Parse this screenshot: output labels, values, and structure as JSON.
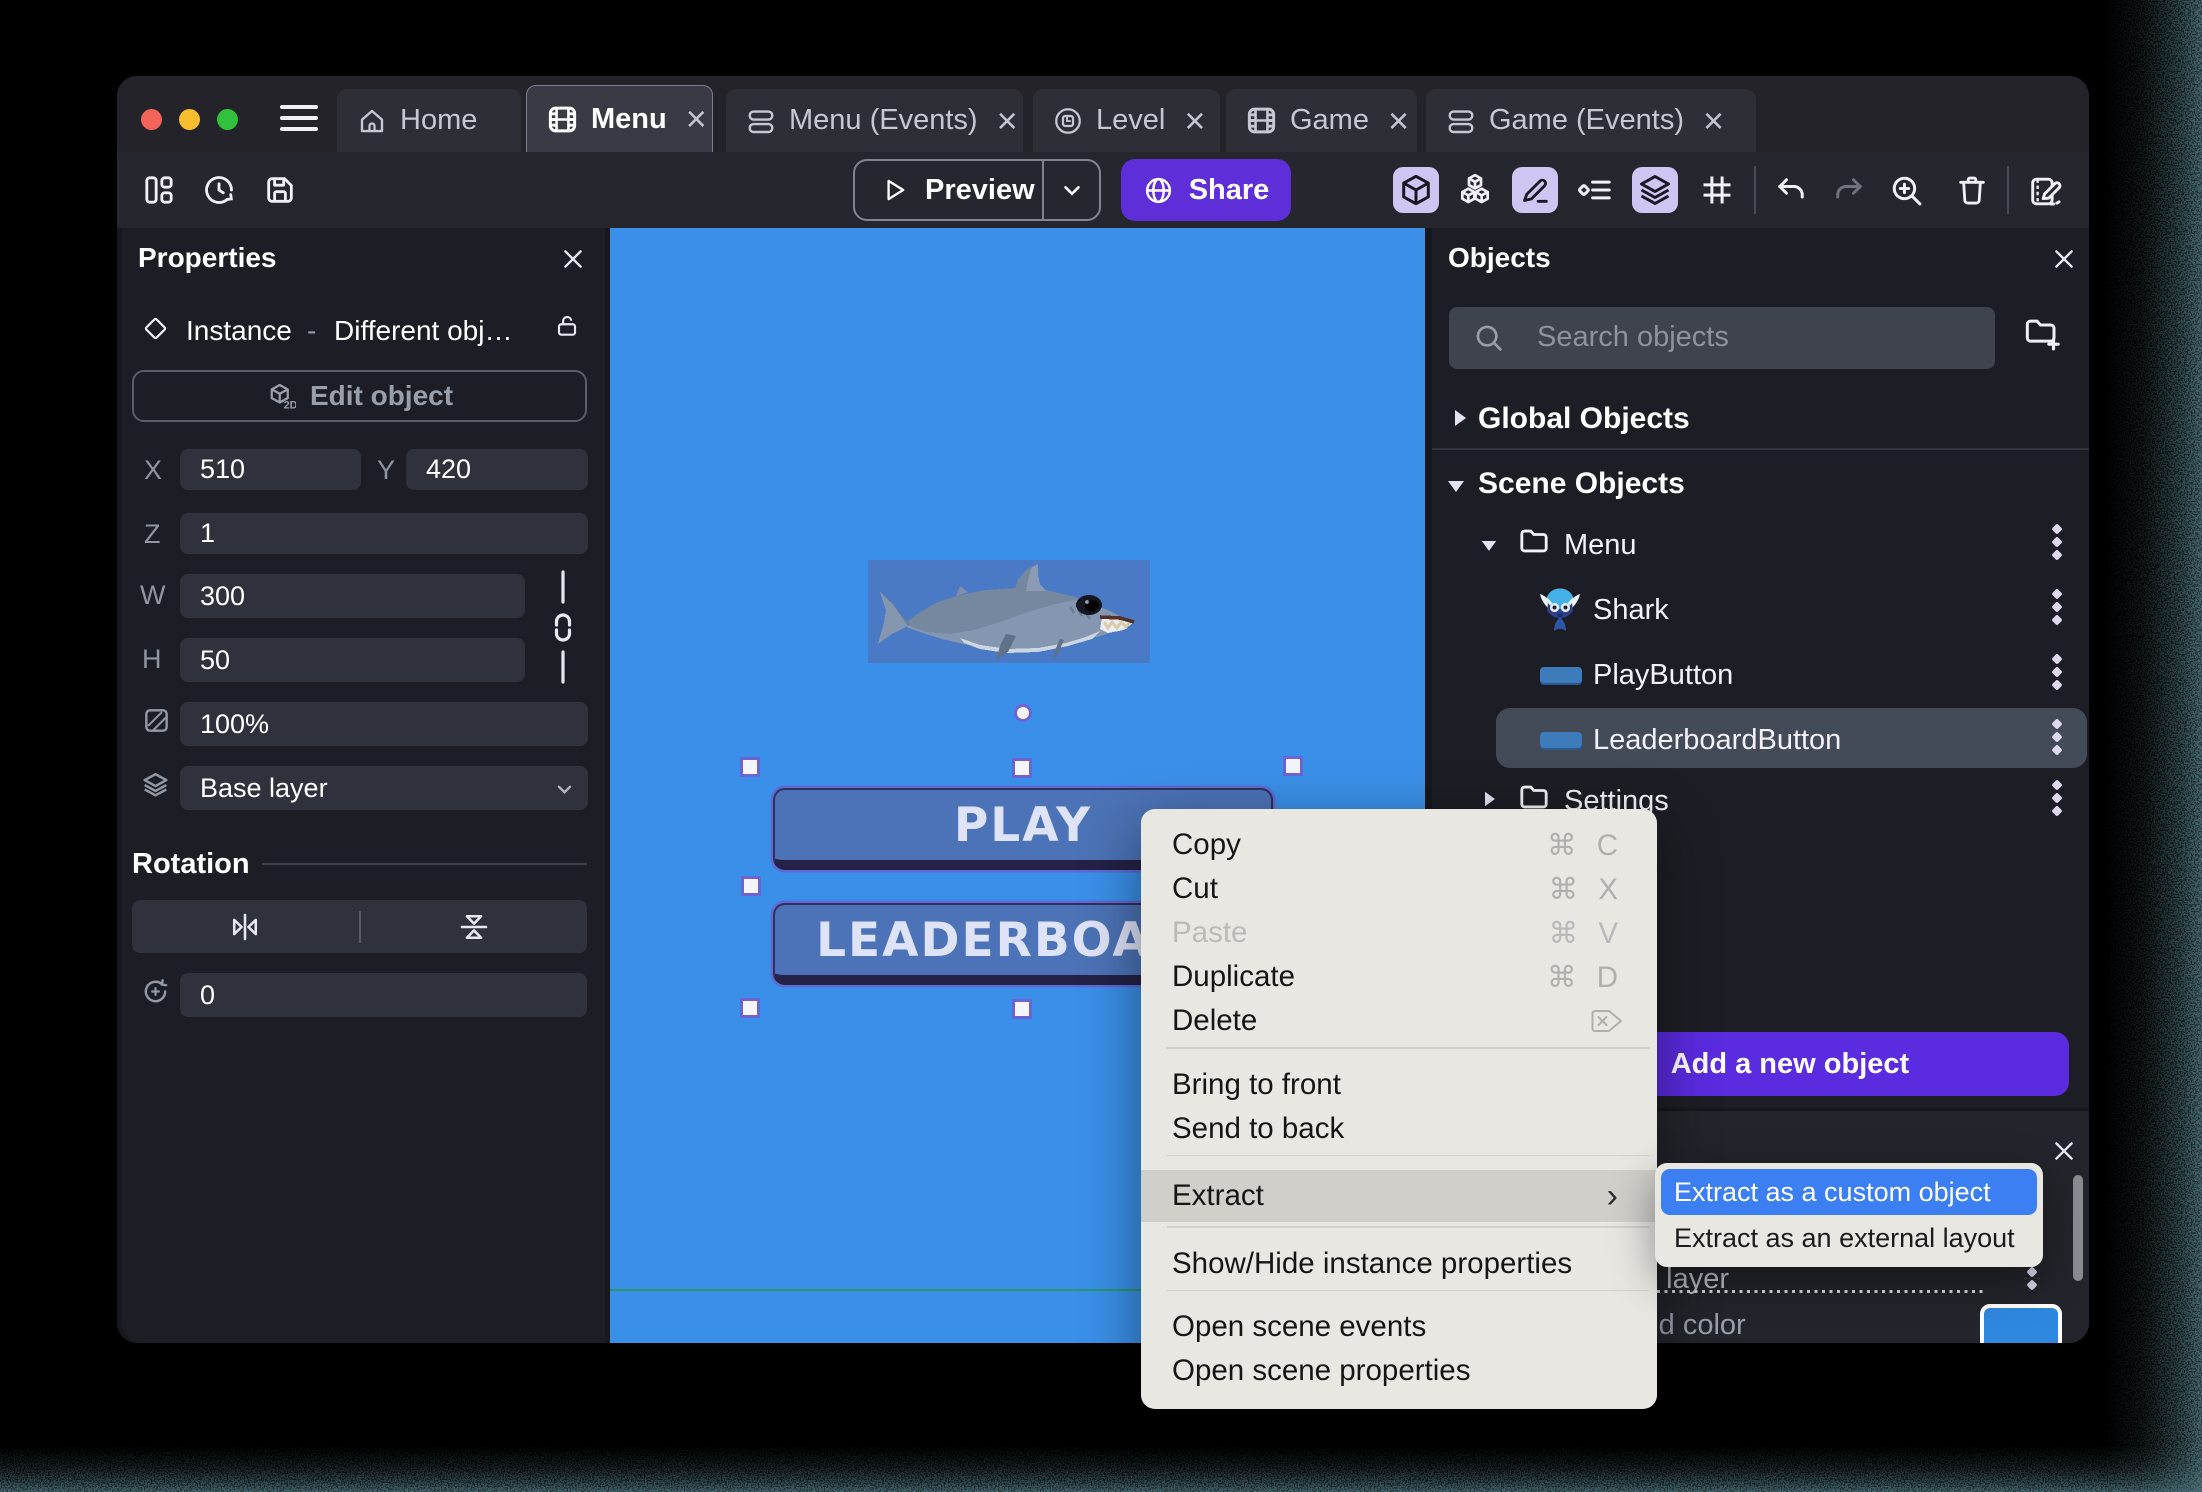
{
  "window": {
    "tabs": [
      {
        "label": "Home",
        "icon": "home-icon",
        "active": false,
        "closable": false
      },
      {
        "label": "Menu",
        "icon": "scene-icon",
        "active": true,
        "closable": true,
        "close": "×"
      },
      {
        "label": "Menu (Events)",
        "icon": "events-icon",
        "active": false,
        "closable": true,
        "close": "×"
      },
      {
        "label": "Level",
        "icon": "external-layout-icon",
        "active": false,
        "closable": true,
        "close": "×"
      },
      {
        "label": "Game",
        "icon": "scene-icon",
        "active": false,
        "closable": true,
        "close": "×"
      },
      {
        "label": "Game (Events)",
        "icon": "events-icon",
        "active": false,
        "closable": true,
        "close": "×"
      }
    ],
    "toolbar": {
      "preview_label": "Preview",
      "share_label": "Share"
    }
  },
  "properties_panel": {
    "title": "Properties",
    "instance": {
      "kind": "Instance",
      "separator": "-",
      "object": "Different obj…"
    },
    "edit_object_label": "Edit object",
    "fields": {
      "x": {
        "label": "X",
        "value": "510"
      },
      "y": {
        "label": "Y",
        "value": "420"
      },
      "z": {
        "label": "Z",
        "value": "1"
      },
      "w": {
        "label": "W",
        "value": "300"
      },
      "h": {
        "label": "H",
        "value": "50"
      },
      "opacity": {
        "value": "100%"
      },
      "layer": {
        "value": "Base layer"
      },
      "rotation": {
        "title": "Rotation",
        "value": "0"
      }
    }
  },
  "objects_panel": {
    "title": "Objects",
    "search_placeholder": "Search objects",
    "sections": {
      "global": "Global Objects",
      "scene": "Scene Objects"
    },
    "tree": {
      "menu_folder": "Menu",
      "shark": "Shark",
      "play_button": "PlayButton",
      "leaderboard_button": "LeaderboardButton",
      "settings_folder": "Settings"
    },
    "add_button_label": "Add a new object",
    "add_button_plus": "+"
  },
  "layers_panel": {
    "layer_name": "Base layer",
    "background_color_label": "Background color",
    "swatch_color": "#2f88e0"
  },
  "canvas": {
    "background_color": "#3a90e9",
    "play_label": "PLAY",
    "leaderboard_label": "LEADERBOARD"
  },
  "context_menu": {
    "items": [
      {
        "label": "Copy",
        "shortcut": "⌘ C"
      },
      {
        "label": "Cut",
        "shortcut": "⌘ X"
      },
      {
        "label": "Paste",
        "shortcut": "⌘ V",
        "disabled": true
      },
      {
        "label": "Duplicate",
        "shortcut": "⌘ D"
      },
      {
        "label": "Delete",
        "shortcut": "⌦"
      },
      {
        "label": "Bring to front"
      },
      {
        "label": "Send to back"
      },
      {
        "label": "Extract",
        "submenu_arrow": "›",
        "highlighted": true
      },
      {
        "label": "Show/Hide instance properties"
      },
      {
        "label": "Open scene events"
      },
      {
        "label": "Open scene properties"
      }
    ],
    "submenu": {
      "items": [
        {
          "label": "Extract as a custom object",
          "selected": true
        },
        {
          "label": "Extract as an external layout"
        }
      ]
    }
  }
}
